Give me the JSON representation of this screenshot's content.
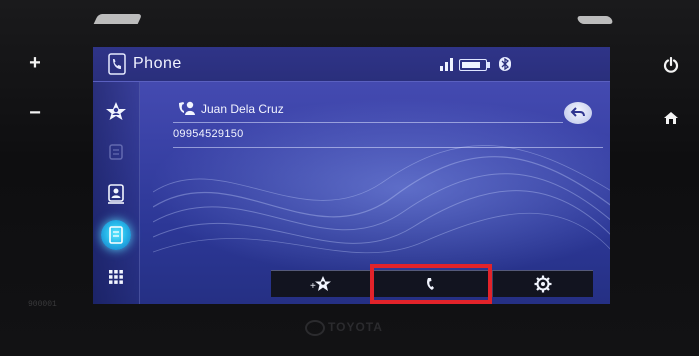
{
  "window": {
    "title": "Phone",
    "title_icon": "phone-app-icon",
    "status_icons": [
      "signal-icon",
      "battery-icon",
      "bluetooth-icon"
    ]
  },
  "hardware": {
    "left_buttons": [
      {
        "icon": "plus-icon",
        "glyph": "+"
      },
      {
        "icon": "minus-icon",
        "glyph": "−"
      }
    ],
    "right_buttons": [
      {
        "icon": "power-icon"
      },
      {
        "icon": "home-icon"
      }
    ],
    "model_code": "900001",
    "brand": "TOYOTA"
  },
  "sidebar": {
    "items": [
      {
        "name": "favorites",
        "icon": "star-contact-icon",
        "active": false
      },
      {
        "name": "history",
        "icon": "call-history-icon",
        "active": false
      },
      {
        "name": "contacts",
        "icon": "contacts-icon",
        "active": false
      },
      {
        "name": "phonebook",
        "icon": "phonebook-icon",
        "active": true
      },
      {
        "name": "keypad",
        "icon": "keypad-icon",
        "active": false
      }
    ]
  },
  "contact": {
    "name": "Juan Dela Cruz",
    "number": "09954529150",
    "icon": "contact-person-icon",
    "back_icon": "back-icon"
  },
  "toolbar": {
    "buttons": [
      {
        "name": "add-favorite",
        "icon": "add-favorite-icon"
      },
      {
        "name": "call",
        "icon": "call-icon",
        "highlighted": true
      },
      {
        "name": "settings",
        "icon": "settings-gear-icon"
      }
    ]
  },
  "colors": {
    "highlight": "#e2232a",
    "active_accent": "#28b9ea",
    "screen_bg": "#3b43a8"
  }
}
